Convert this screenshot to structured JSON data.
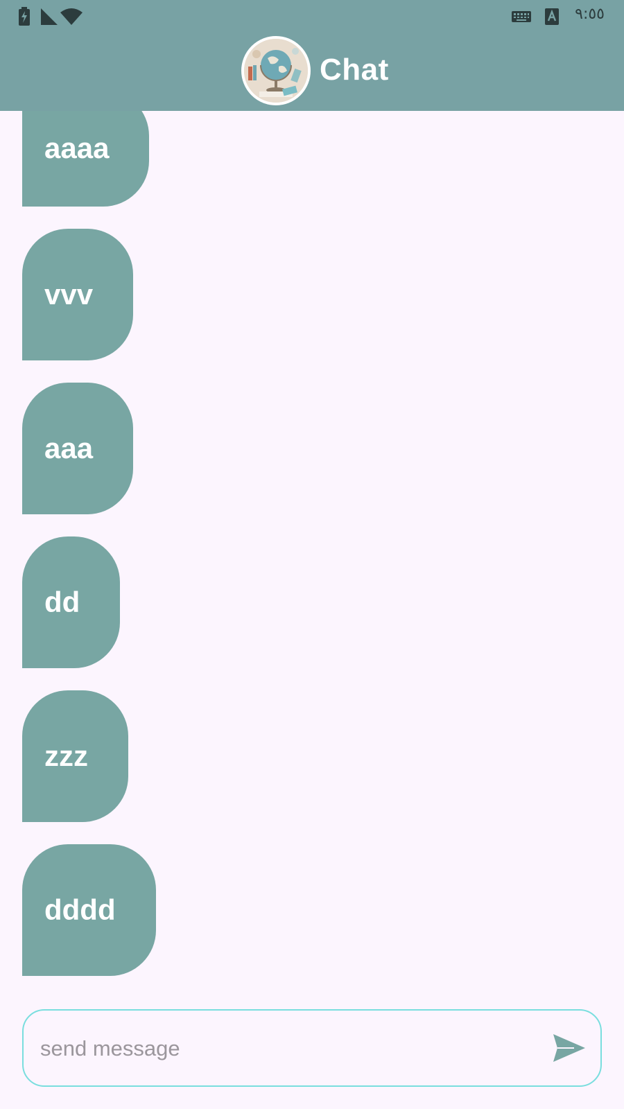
{
  "status_bar": {
    "time": "٩:٥٥",
    "icons": [
      "battery-charging-icon",
      "cell-signal-icon",
      "wifi-icon",
      "keyboard-icon",
      "accessibility-a-icon"
    ]
  },
  "app_bar": {
    "title": "Chat",
    "avatar": "globe-avatar-image",
    "background": "#78a2a4"
  },
  "messages": [
    {
      "text": "aaaa"
    },
    {
      "text": "vvv"
    },
    {
      "text": "aaa"
    },
    {
      "text": "dd"
    },
    {
      "text": "zzz"
    },
    {
      "text": "dddd"
    }
  ],
  "composer": {
    "placeholder": "send message",
    "value": "",
    "send_icon": "send-icon",
    "border_color": "#79dede"
  },
  "colors": {
    "accent": "#78a6a3",
    "background": "#fcf5fe",
    "bubble_text": "#ffffff"
  }
}
